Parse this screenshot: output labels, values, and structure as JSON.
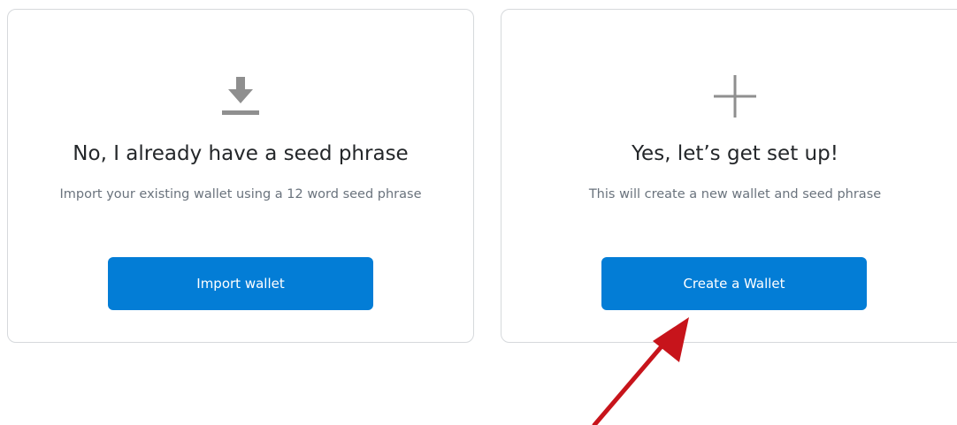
{
  "cards": {
    "import": {
      "icon": "download-icon",
      "title": "No, I already have a seed phrase",
      "subtitle": "Import your existing wallet using a 12 word seed phrase",
      "button_label": "Import wallet"
    },
    "create": {
      "icon": "plus-icon",
      "title": "Yes, let’s get set up!",
      "subtitle": "This will create a new wallet and seed phrase",
      "button_label": "Create a Wallet"
    }
  },
  "colors": {
    "button_bg": "#037dd6",
    "icon_gray": "#8f8f8f",
    "card_border": "#d6d9dc",
    "annotation_arrow": "#c7141b"
  }
}
